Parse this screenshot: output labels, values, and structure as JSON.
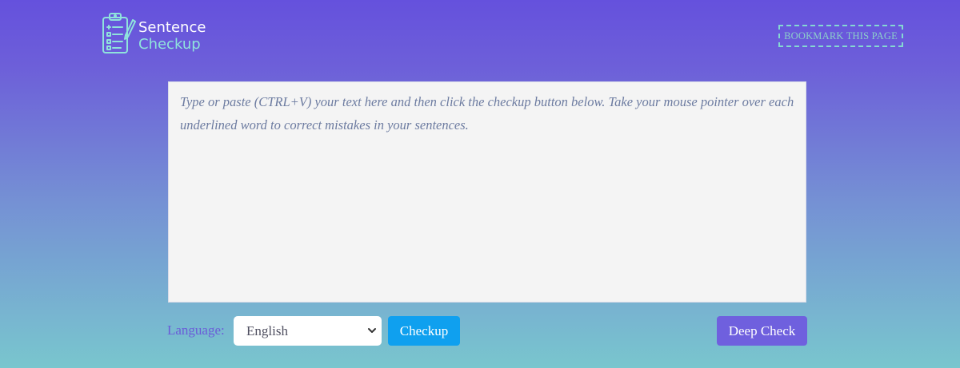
{
  "header": {
    "logo": {
      "icon": "clipboard-checklist-icon",
      "line1": "Sentence",
      "line2": "Checkup"
    },
    "bookmark_label": "BOOKMARK THIS PAGE"
  },
  "editor": {
    "placeholder": "Type or paste (CTRL+V) your text here and then click the checkup button below. Take your mouse pointer over each underlined word to correct mistakes in your sentences."
  },
  "controls": {
    "language_label": "Language:",
    "language_selected": "English",
    "checkup_label": "Checkup",
    "deep_check_label": "Deep Check"
  },
  "colors": {
    "checkup_button": "#0fa0ef",
    "deep_check_button": "#6f60de",
    "logo_accent": "#8fe3dc"
  }
}
